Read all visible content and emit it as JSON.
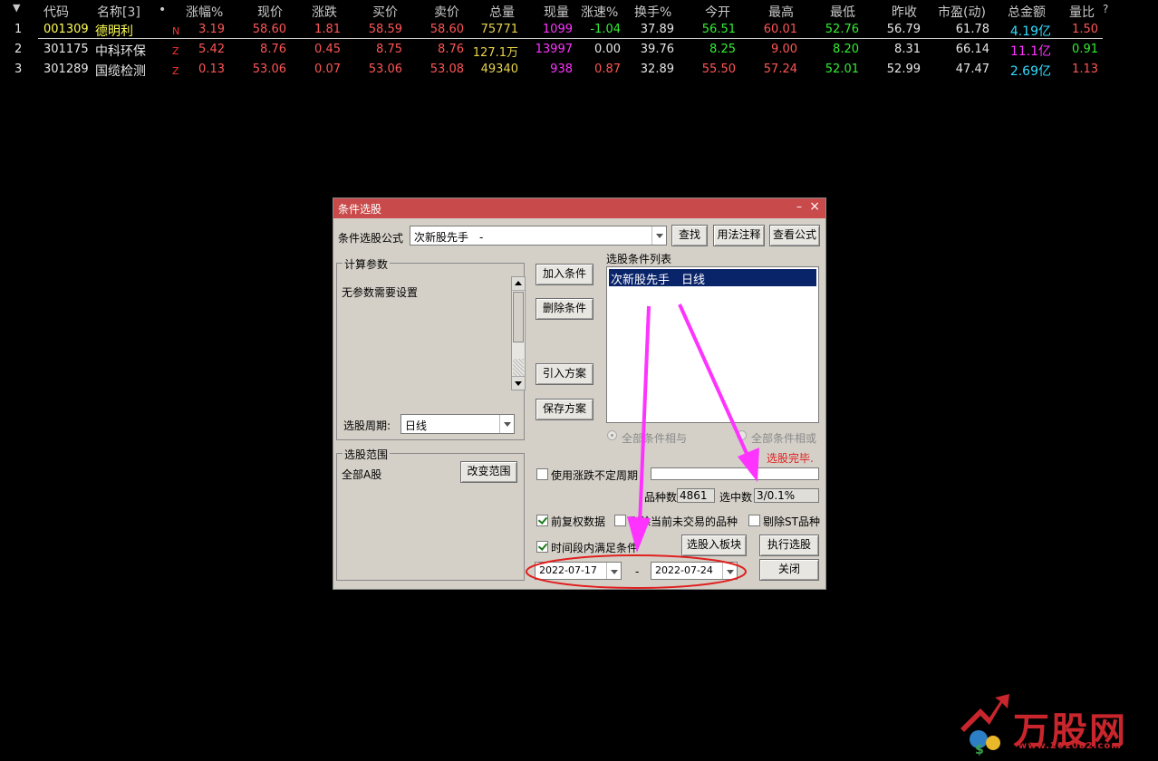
{
  "header": {
    "sort_arrow": "▼",
    "cols": [
      "代码",
      "名称[3]",
      "•",
      "涨幅%",
      "现价",
      "涨跌",
      "买价",
      "卖价",
      "总量",
      "现量",
      "涨速%",
      "换手%",
      "今开",
      "最高",
      "最低",
      "昨收",
      "市盈(动)",
      "总金额",
      "量比",
      "?"
    ]
  },
  "rows": [
    {
      "idx": "1",
      "code": "001309",
      "name": "德明利",
      "flag": "N",
      "chg_pct": "3.19",
      "price": "58.60",
      "chg": "1.81",
      "bid": "58.59",
      "ask": "58.60",
      "vol": "75771",
      "cur_vol": "1099",
      "speed": "-1.04",
      "turnover": "37.89",
      "open": "56.51",
      "high": "60.01",
      "low": "52.76",
      "prev": "56.79",
      "pe": "61.78",
      "amount": "4.19亿",
      "vol_ratio": "1.50"
    },
    {
      "idx": "2",
      "code": "301175",
      "name": "中科环保",
      "flag": "Z",
      "chg_pct": "5.42",
      "price": "8.76",
      "chg": "0.45",
      "bid": "8.75",
      "ask": "8.76",
      "vol": "127.1万",
      "cur_vol": "13997",
      "speed": "0.00",
      "turnover": "39.76",
      "open": "8.25",
      "high": "9.00",
      "low": "8.20",
      "prev": "8.31",
      "pe": "66.14",
      "amount": "11.1亿",
      "vol_ratio": "0.91"
    },
    {
      "idx": "3",
      "code": "301289",
      "name": "国缆检测",
      "flag": "Z",
      "chg_pct": "0.13",
      "price": "53.06",
      "chg": "0.07",
      "bid": "53.06",
      "ask": "53.08",
      "vol": "49340",
      "cur_vol": "938",
      "speed": "0.87",
      "turnover": "32.89",
      "open": "55.50",
      "high": "57.24",
      "low": "52.01",
      "prev": "52.99",
      "pe": "47.47",
      "amount": "2.69亿",
      "vol_ratio": "1.13"
    }
  ],
  "dialog": {
    "title": "条件选股",
    "minimize": "–",
    "close": "×",
    "formula_label": "条件选股公式",
    "formula_value": "次新股先手　-",
    "find_btn": "查找",
    "usage_btn": "用法注释",
    "view_btn": "查看公式",
    "calc_group": "计算参数",
    "no_params": "无参数需要设置",
    "period_label": "选股周期:",
    "period_value": "日线",
    "range_group": "选股范围",
    "range_value": "全部A股",
    "change_range_btn": "改变范围",
    "add_btn": "加入条件",
    "del_btn": "删除条件",
    "import_btn": "引入方案",
    "save_btn": "保存方案",
    "list_label": "选股条件列表",
    "list_items": [
      "次新股先手　日线"
    ],
    "radio_and": "全部条件相与",
    "radio_or": "全部条件相或",
    "status": "选股完毕.",
    "use_irregular": "使用涨跌不定周期",
    "count_label": "品种数",
    "count_value": "4861",
    "selected_label": "选中数",
    "selected_value": "3/0.1%",
    "adj_label": "前复权数据",
    "exclude_untraded": "剔除当前未交易的品种",
    "exclude_st": "剔除ST品种",
    "period_cond": "时间段内满足条件",
    "to_block_btn": "选股入板块",
    "run_btn": "执行选股",
    "date_from": "2022-07-17",
    "date_sep": "-",
    "date_to": "2022-07-24",
    "close_btn": "关闭"
  },
  "watermark": {
    "brand": "万股网",
    "url": "www.201082.com"
  },
  "colors": {
    "up": "#ff5555",
    "down": "#33ee33",
    "code": "#ffff55",
    "annotation": "#ff33ff",
    "ellipse": "#e02020"
  }
}
